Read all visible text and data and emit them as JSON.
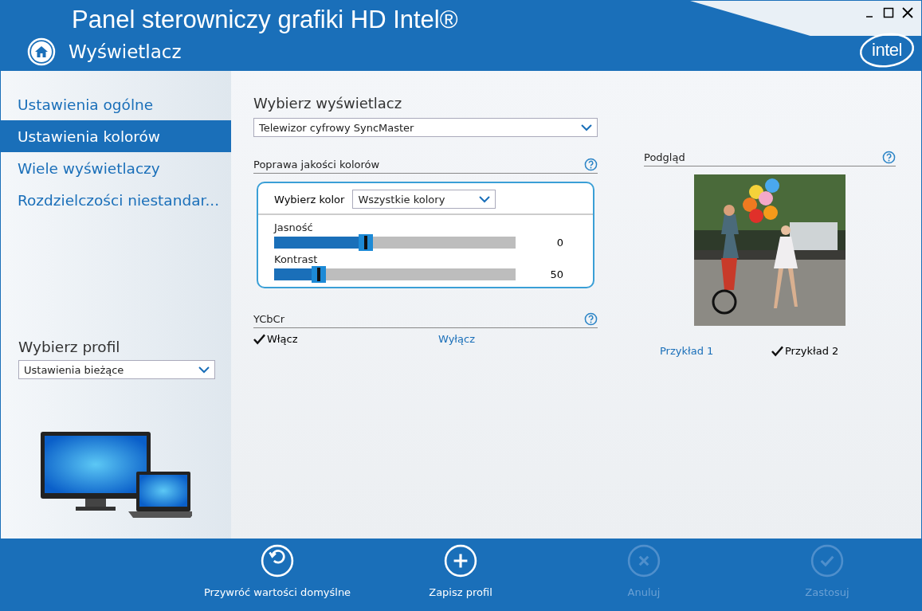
{
  "window": {
    "title": "Panel sterowniczy grafiki HD Intel®",
    "section": "Wyświetlacz",
    "logo": "intel"
  },
  "sidebar": {
    "items": [
      {
        "label": "Ustawienia ogólne",
        "selected": false
      },
      {
        "label": "Ustawienia kolorów",
        "selected": true
      },
      {
        "label": "Wiele wyświetlaczy",
        "selected": false
      },
      {
        "label": "Rozdzielczości niestandar...",
        "selected": false
      }
    ],
    "profile": {
      "label": "Wybierz profil",
      "value": "Ustawienia bieżące"
    }
  },
  "display": {
    "label": "Wybierz wyświetlacz",
    "value": "Telewizor cyfrowy SyncMaster"
  },
  "color_enhancement": {
    "title": "Poprawa jakości kolorów",
    "color_label": "Wybierz kolor",
    "color_value": "Wszystkie kolory",
    "sliders": [
      {
        "label": "Jasność",
        "level": 0.38,
        "reading": "0"
      },
      {
        "label": "Kontrast",
        "level": 0.185,
        "reading": "50"
      }
    ]
  },
  "ycbcr": {
    "title": "YCbCr",
    "options": [
      {
        "label": "Włącz",
        "selected": true
      },
      {
        "label": "Wyłącz",
        "selected": false
      }
    ]
  },
  "preview": {
    "title": "Podgląd",
    "options": [
      {
        "label": "Przykład 1",
        "selected": false
      },
      {
        "label": "Przykład 2",
        "selected": true
      }
    ]
  },
  "footer": {
    "buttons": [
      {
        "label": "Przywróć wartości domyślne",
        "kind": "restore",
        "disabled": false
      },
      {
        "label": "Zapisz profil",
        "kind": "add",
        "disabled": false
      },
      {
        "label": "Anuluj",
        "kind": "cancel",
        "disabled": true
      },
      {
        "label": "Zastosuj",
        "kind": "apply",
        "disabled": true
      }
    ]
  }
}
